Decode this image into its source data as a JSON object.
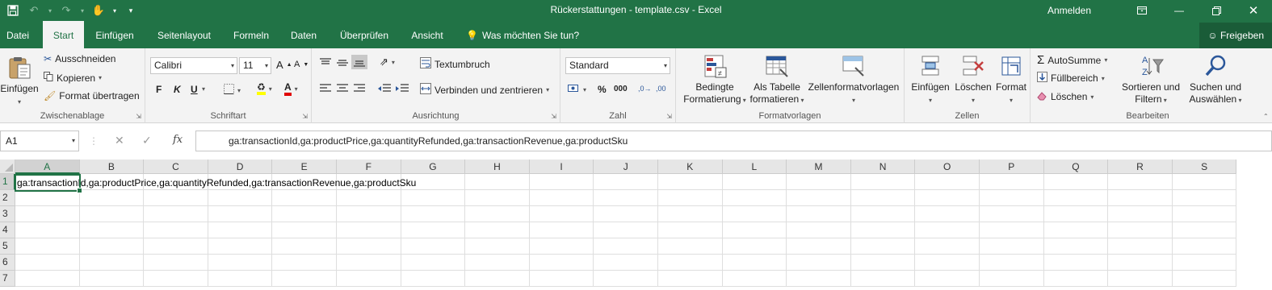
{
  "window": {
    "title": "Rückerstattungen - template.csv  -  Excel",
    "signin": "Anmelden",
    "share": "Freigeben",
    "minimize_icon": "ribbon-display-icon",
    "restore_icon": "restore-icon"
  },
  "tabs": [
    "Datei",
    "Start",
    "Einfügen",
    "Seitenlayout",
    "Formeln",
    "Daten",
    "Überprüfen",
    "Ansicht"
  ],
  "active_tab": "Start",
  "tell_me": "Was möchten Sie tun?",
  "ribbon": {
    "clipboard": {
      "label": "Zwischenablage",
      "paste": "Einfügen",
      "cut": "Ausschneiden",
      "copy": "Kopieren",
      "format_painter": "Format übertragen"
    },
    "font": {
      "label": "Schriftart",
      "font_name": "Calibri",
      "font_size": "11",
      "bold": "F",
      "italic": "K",
      "underline": "U",
      "grow": "A",
      "shrink": "A"
    },
    "alignment": {
      "label": "Ausrichtung",
      "wrap": "Textumbruch",
      "merge": "Verbinden und zentrieren"
    },
    "number": {
      "label": "Zahl",
      "format": "Standard",
      "percent": "%",
      "thousands": "000",
      "inc_decimal": ",0→",
      "dec_decimal": ",00"
    },
    "styles": {
      "label": "Formatvorlagen",
      "conditional_line1": "Bedingte",
      "conditional_line2": "Formatierung",
      "table_line1": "Als Tabelle",
      "table_line2": "formatieren",
      "cell_styles": "Zellenformatvorlagen"
    },
    "cells": {
      "label": "Zellen",
      "insert": "Einfügen",
      "delete": "Löschen",
      "format": "Format"
    },
    "editing": {
      "label": "Bearbeiten",
      "autosum": "AutoSumme",
      "fill": "Füllbereich",
      "clear": "Löschen",
      "sort_line1": "Sortieren und",
      "sort_line2": "Filtern",
      "find_line1": "Suchen und",
      "find_line2": "Auswählen"
    }
  },
  "formula_bar": {
    "name_box": "A1",
    "fx": "fx",
    "formula": "ga:transactionId,ga:productPrice,ga:quantityRefunded,ga:transactionRevenue,ga:productSku"
  },
  "sheet": {
    "columns": [
      "A",
      "B",
      "C",
      "D",
      "E",
      "F",
      "G",
      "H",
      "I",
      "J",
      "K",
      "L",
      "M",
      "N",
      "O",
      "P",
      "Q",
      "R",
      "S"
    ],
    "rows": [
      "1",
      "2",
      "3",
      "4",
      "5",
      "6",
      "7"
    ],
    "a1_value": "ga:transactionId,ga:productPrice,ga:quantityRefunded,ga:transactionRevenue,ga:productSku",
    "selected_cell": "A1"
  },
  "colors": {
    "accent": "#217346",
    "ribbon_bg": "#f3f3f3",
    "header_bg": "#e6e6e6"
  }
}
